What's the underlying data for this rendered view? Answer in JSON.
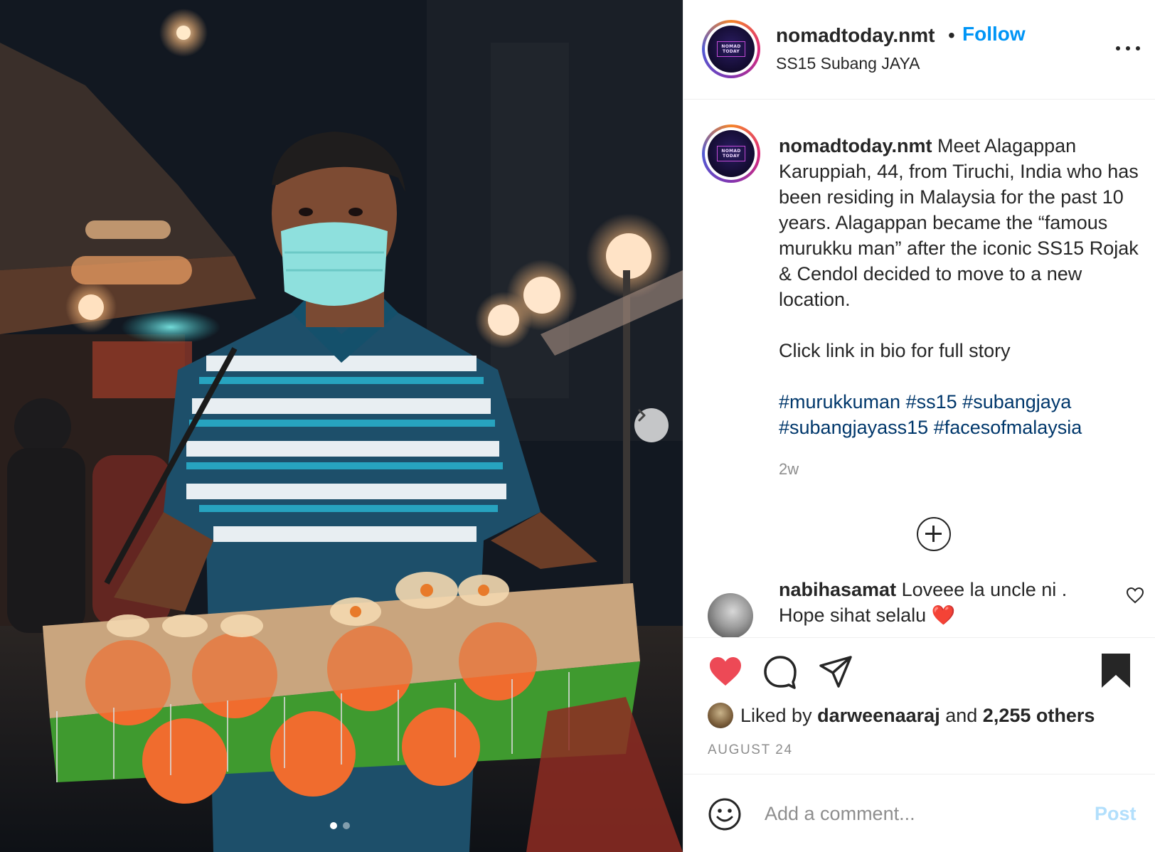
{
  "post": {
    "username": "nomadtoday.nmt",
    "location": "SS15 Subang JAYA",
    "follow_label": "Follow",
    "separator": "•",
    "avatar_logo_line1": "NOMAD",
    "avatar_logo_line2": "TODAY"
  },
  "photo": {
    "carousel_index": 1,
    "carousel_count": 2,
    "next_icon": "chevron-right-icon"
  },
  "caption": {
    "username": "nomadtoday.nmt",
    "text": "Meet Alagappan Karuppiah, 44, from Tiruchi, India who has been residing in Malaysia for the past 10 years. Alagappan became the “famous murukku man” after the iconic SS15 Rojak & Cendol decided to move to a new location.",
    "cta": "Click link in bio for full story",
    "hashtags": [
      "#murukkuman",
      "#ss15",
      "#subangjaya",
      "#subangjayass15",
      "#facesofmalaysia"
    ],
    "time": "2w"
  },
  "comments": [
    {
      "username": "nabihasamat",
      "text": "Loveee la uncle ni . Hope sihat selalu ❤️"
    }
  ],
  "actions": {
    "liked": true,
    "saved": true,
    "like_color": "#ed4956",
    "icons": [
      "heart-icon",
      "comment-icon",
      "share-icon",
      "bookmark-icon"
    ]
  },
  "likes": {
    "prefix": "Liked by",
    "user": "darweenaaraj",
    "middle": "and",
    "others": "2,255 others"
  },
  "date": "AUGUST 24",
  "comment_box": {
    "placeholder": "Add a comment...",
    "post_label": "Post"
  },
  "colors": {
    "link": "#0095f6",
    "hashtag": "#00376b",
    "muted": "#8e8e8e"
  }
}
